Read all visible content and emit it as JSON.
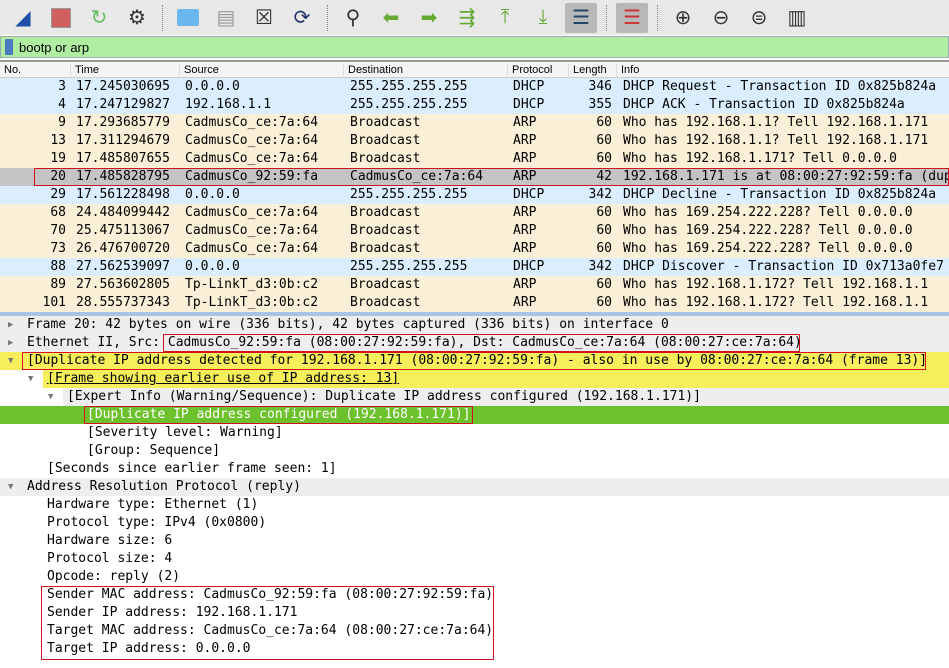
{
  "toolbar": {
    "icons": [
      "shark-fin-start-icon",
      "stop-icon",
      "restart-icon",
      "options-gear-icon",
      "open-folder-icon",
      "file-icon",
      "close-file-icon",
      "reload-icon",
      "find-icon",
      "back-arrow-icon",
      "forward-arrow-icon",
      "go-to-packet-icon",
      "first-packet-icon",
      "last-packet-icon",
      "autoscroll-icon",
      "colorize-icon",
      "zoom-in-icon",
      "zoom-out-icon",
      "normal-size-icon",
      "resize-columns-icon"
    ]
  },
  "filter": {
    "value": "bootp or arp"
  },
  "columns": [
    "No.",
    "Time",
    "Source",
    "Destination",
    "Protocol",
    "Length",
    "Info"
  ],
  "packets": [
    {
      "no": "3",
      "time": "17.245030695",
      "src": "0.0.0.0",
      "dst": "255.255.255.255",
      "proto": "DHCP",
      "len": "346",
      "info": "DHCP Request  - Transaction ID 0x825b824a"
    },
    {
      "no": "4",
      "time": "17.247129827",
      "src": "192.168.1.1",
      "dst": "255.255.255.255",
      "proto": "DHCP",
      "len": "355",
      "info": "DHCP ACK      - Transaction ID 0x825b824a"
    },
    {
      "no": "9",
      "time": "17.293685779",
      "src": "CadmusCo_ce:7a:64",
      "dst": "Broadcast",
      "proto": "ARP",
      "len": "60",
      "info": "Who has 192.168.1.1? Tell 192.168.1.171"
    },
    {
      "no": "13",
      "time": "17.311294679",
      "src": "CadmusCo_ce:7a:64",
      "dst": "Broadcast",
      "proto": "ARP",
      "len": "60",
      "info": "Who has 192.168.1.1? Tell 192.168.1.171"
    },
    {
      "no": "19",
      "time": "17.485807655",
      "src": "CadmusCo_ce:7a:64",
      "dst": "Broadcast",
      "proto": "ARP",
      "len": "60",
      "info": "Who has 192.168.1.171? Tell 0.0.0.0"
    },
    {
      "no": "20",
      "time": "17.485828795",
      "src": "CadmusCo_92:59:fa",
      "dst": "CadmusCo_ce:7a:64",
      "proto": "ARP",
      "len": "42",
      "info": "192.168.1.171 is at 08:00:27:92:59:fa (dup"
    },
    {
      "no": "29",
      "time": "17.561228498",
      "src": "0.0.0.0",
      "dst": "255.255.255.255",
      "proto": "DHCP",
      "len": "342",
      "info": "DHCP Decline  - Transaction ID 0x825b824a"
    },
    {
      "no": "68",
      "time": "24.484099442",
      "src": "CadmusCo_ce:7a:64",
      "dst": "Broadcast",
      "proto": "ARP",
      "len": "60",
      "info": "Who has 169.254.222.228? Tell 0.0.0.0"
    },
    {
      "no": "70",
      "time": "25.475113067",
      "src": "CadmusCo_ce:7a:64",
      "dst": "Broadcast",
      "proto": "ARP",
      "len": "60",
      "info": "Who has 169.254.222.228? Tell 0.0.0.0"
    },
    {
      "no": "73",
      "time": "26.476700720",
      "src": "CadmusCo_ce:7a:64",
      "dst": "Broadcast",
      "proto": "ARP",
      "len": "60",
      "info": "Who has 169.254.222.228? Tell 0.0.0.0"
    },
    {
      "no": "88",
      "time": "27.562539097",
      "src": "0.0.0.0",
      "dst": "255.255.255.255",
      "proto": "DHCP",
      "len": "342",
      "info": "DHCP Discover - Transaction ID 0x713a0fe7"
    },
    {
      "no": "89",
      "time": "27.563602805",
      "src": "Tp-LinkT_d3:0b:c2",
      "dst": "Broadcast",
      "proto": "ARP",
      "len": "60",
      "info": "Who has 192.168.1.172? Tell 192.168.1.1"
    },
    {
      "no": "101",
      "time": "28.555737343",
      "src": "Tp-LinkT_d3:0b:c2",
      "dst": "Broadcast",
      "proto": "ARP",
      "len": "60",
      "info": "Who has 192.168.1.172? Tell 192.168.1.1"
    }
  ],
  "selected_packet": "20",
  "details": [
    {
      "text": "Frame 20: 42 bytes on wire (336 bits), 42 bytes captured (336 bits) on interface 0",
      "level": 0,
      "tri": "right",
      "style": "g"
    },
    {
      "text": "Ethernet II, Src: CadmusCo_92:59:fa (08:00:27:92:59:fa), Dst: CadmusCo_ce:7a:64 (08:00:27:ce:7a:64)",
      "level": 0,
      "tri": "right",
      "style": "g"
    },
    {
      "text": "[Duplicate IP address detected for 192.168.1.171 (08:00:27:92:59:fa) - also in use by 08:00:27:ce:7a:64 (frame 13)]",
      "level": 0,
      "tri": "down",
      "style": "y"
    },
    {
      "text": "[Frame showing earlier use of IP address: 13]",
      "level": 1,
      "tri": "down",
      "style": "y u"
    },
    {
      "text": "[Expert Info (Warning/Sequence): Duplicate IP address configured (192.168.1.171)]",
      "level": 2,
      "tri": "down",
      "style": "g"
    },
    {
      "text": "[Duplicate IP address configured (192.168.1.171)]",
      "level": 3,
      "tri": "",
      "style": "grn"
    },
    {
      "text": "[Severity level: Warning]",
      "level": 3,
      "tri": "",
      "style": ""
    },
    {
      "text": "[Group: Sequence]",
      "level": 3,
      "tri": "",
      "style": ""
    },
    {
      "text": "[Seconds since earlier frame seen: 1]",
      "level": 1,
      "tri": "",
      "style": ""
    },
    {
      "text": "Address Resolution Protocol (reply)",
      "level": 0,
      "tri": "down",
      "style": "g"
    },
    {
      "text": "Hardware type: Ethernet (1)",
      "level": 1,
      "tri": "",
      "style": ""
    },
    {
      "text": "Protocol type: IPv4 (0x0800)",
      "level": 1,
      "tri": "",
      "style": ""
    },
    {
      "text": "Hardware size: 6",
      "level": 1,
      "tri": "",
      "style": ""
    },
    {
      "text": "Protocol size: 4",
      "level": 1,
      "tri": "",
      "style": ""
    },
    {
      "text": "Opcode: reply (2)",
      "level": 1,
      "tri": "",
      "style": ""
    },
    {
      "text": "Sender MAC address: CadmusCo_92:59:fa (08:00:27:92:59:fa)",
      "level": 1,
      "tri": "",
      "style": ""
    },
    {
      "text": "Sender IP address: 192.168.1.171",
      "level": 1,
      "tri": "",
      "style": ""
    },
    {
      "text": "Target MAC address: CadmusCo_ce:7a:64 (08:00:27:ce:7a:64)",
      "level": 1,
      "tri": "",
      "style": ""
    },
    {
      "text": "Target IP address: 0.0.0.0",
      "level": 1,
      "tri": "",
      "style": ""
    }
  ],
  "colors": {
    "dhcp_row": "#daeeff",
    "arp_row": "#faf0d7",
    "selected_row": "#c4c4c4",
    "filter_valid": "#afeea0",
    "warning_highlight": "#f6ee5a",
    "selected_detail": "#6cc12c",
    "annotation_box": "#d0121f"
  }
}
